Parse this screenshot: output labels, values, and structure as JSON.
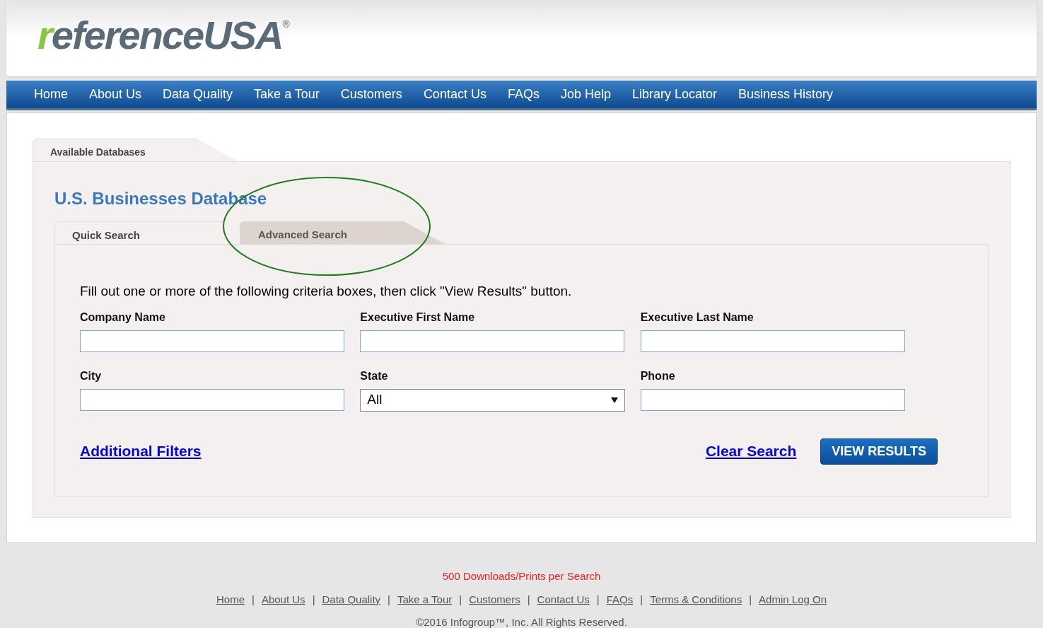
{
  "header": {
    "logo": "referenceUSA",
    "logo_mark": "®"
  },
  "nav": [
    "Home",
    "About Us",
    "Data Quality",
    "Take a Tour",
    "Customers",
    "Contact Us",
    "FAQs",
    "Job Help",
    "Library Locator",
    "Business History"
  ],
  "panel_tab": "Available Databases",
  "database_title": "U.S. Businesses Database",
  "search_tabs": [
    {
      "label": "Quick Search",
      "selected": true
    },
    {
      "label": "Advanced Search",
      "selected": false
    }
  ],
  "instructions": "Fill out one or more of the following criteria boxes, then click \"View Results\" button.",
  "fields": [
    {
      "label": "Company Name",
      "kind": "text"
    },
    {
      "label": "Executive First Name",
      "kind": "text"
    },
    {
      "label": "Executive Last Name",
      "kind": "text"
    },
    {
      "label": "City",
      "kind": "text"
    },
    {
      "label": "State",
      "kind": "select",
      "value": "All"
    },
    {
      "label": "Phone",
      "kind": "text"
    }
  ],
  "additional_filters": "Additional Filters",
  "clear_search": "Clear Search",
  "view_results": "VIEW RESULTS",
  "footer": {
    "notice": "500 Downloads/Prints per Search",
    "links": [
      "Home",
      "About Us",
      "Data Quality",
      "Take a Tour",
      "Customers",
      "Contact Us",
      "FAQs",
      "Terms & Conditions",
      "Admin Log On"
    ],
    "separator": "|",
    "copyright": "©2016 Infogroup™, Inc. All Rights Reserved."
  }
}
